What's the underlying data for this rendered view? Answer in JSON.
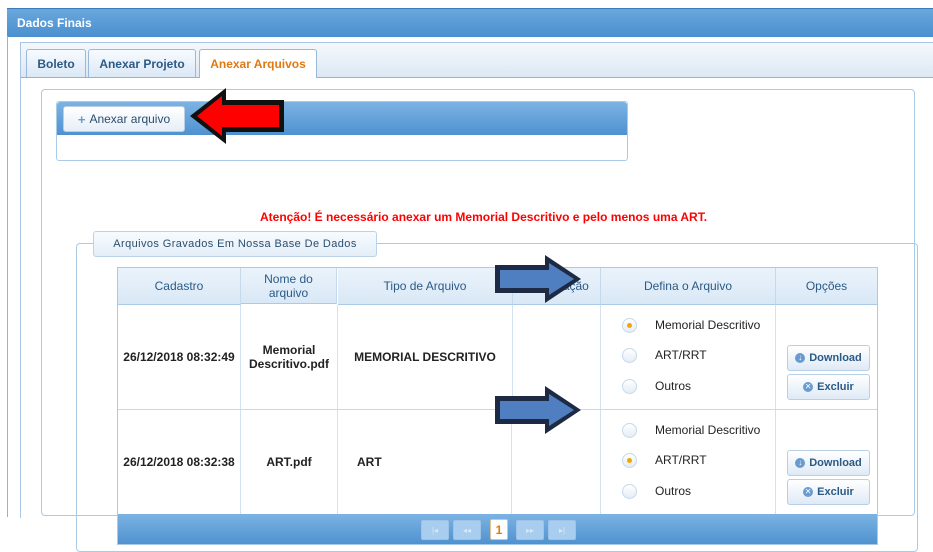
{
  "window": {
    "title": "Dados Finais"
  },
  "tabs": [
    {
      "label": "Boleto",
      "active": false
    },
    {
      "label": "Anexar Projeto",
      "active": false
    },
    {
      "label": "Anexar Arquivos",
      "active": true
    }
  ],
  "upload": {
    "button_label": "Anexar arquivo",
    "button_icon": "plus-icon"
  },
  "warning_text": "Atenção! É necessário anexar um Memorial Descritivo e pelo menos uma ART.",
  "files_section": {
    "legend": "Arquivos Gravados Em Nossa Base De Dados"
  },
  "table": {
    "headers": [
      "Cadastro",
      "Nome do arquivo",
      "Tipo de Arquivo",
      "Observação",
      "Defina o Arquivo",
      "Opções"
    ],
    "rows": [
      {
        "cadastro": "26/12/2018 08:32:49",
        "nome": "Memorial Descritivo.pdf",
        "tipo": "MEMORIAL DESCRITIVO",
        "observacao": "",
        "options": [
          "Memorial Descritivo",
          "ART/RRT",
          "Outros"
        ],
        "selected": "Memorial Descritivo"
      },
      {
        "cadastro": "26/12/2018 08:32:38",
        "nome": "ART.pdf",
        "tipo": "ART",
        "observacao": "",
        "options": [
          "Memorial Descritivo",
          "ART/RRT",
          "Outros"
        ],
        "selected": "ART/RRT"
      }
    ],
    "actions": {
      "download_label": "Download",
      "delete_label": "Excluir"
    }
  },
  "pager": {
    "current_page": "1",
    "first": "|◂",
    "prev": "◂◂",
    "next": "▸▸",
    "last": "▸|"
  },
  "colors": {
    "title_bar": "#4a8fcf",
    "active_tab": "#e07a10",
    "warning": "#ff0000",
    "radio_selected": "#f5a500",
    "annotation_red_arrow": "#ff0000",
    "annotation_blue_arrow": "#4f7fc0"
  }
}
